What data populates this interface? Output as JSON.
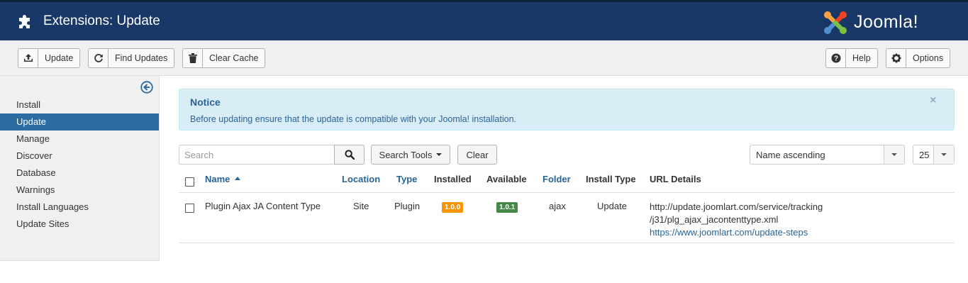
{
  "header": {
    "title": "Extensions: Update",
    "brand": "Joomla!"
  },
  "toolbar": {
    "update_label": "Update",
    "find_updates_label": "Find Updates",
    "clear_cache_label": "Clear Cache",
    "help_label": "Help",
    "options_label": "Options"
  },
  "sidebar": {
    "items": [
      {
        "label": "Install"
      },
      {
        "label": "Update",
        "active": true
      },
      {
        "label": "Manage"
      },
      {
        "label": "Discover"
      },
      {
        "label": "Database"
      },
      {
        "label": "Warnings"
      },
      {
        "label": "Install Languages"
      },
      {
        "label": "Update Sites"
      }
    ]
  },
  "notice": {
    "title": "Notice",
    "message": "Before updating ensure that the update is compatible with your Joomla! installation.",
    "close": "×"
  },
  "filters": {
    "search_placeholder": "Search",
    "search_tools_label": "Search Tools",
    "clear_label": "Clear",
    "ordering_value": "Name ascending",
    "limit_value": "25"
  },
  "table": {
    "headers": {
      "name": "Name",
      "location": "Location",
      "type": "Type",
      "installed": "Installed",
      "available": "Available",
      "folder": "Folder",
      "install_type": "Install Type",
      "url_details": "URL Details"
    },
    "rows": [
      {
        "name": "Plugin Ajax JA Content Type",
        "location": "Site",
        "type": "Plugin",
        "installed": "1.0.0",
        "available": "1.0.1",
        "folder": "ajax",
        "install_type": "Update",
        "url_line1": "http://update.joomlart.com/service/tracking",
        "url_line2": "/j31/plg_ajax_jacontenttype.xml",
        "info_link": "https://www.joomlart.com/update-steps"
      }
    ]
  },
  "colors": {
    "header_bg": "#1a3867",
    "sidebar_active": "#2d6ca2",
    "link": "#2a6496",
    "notice_bg": "#d9edf7",
    "installed_badge": "#f89406",
    "available_badge": "#468847"
  }
}
